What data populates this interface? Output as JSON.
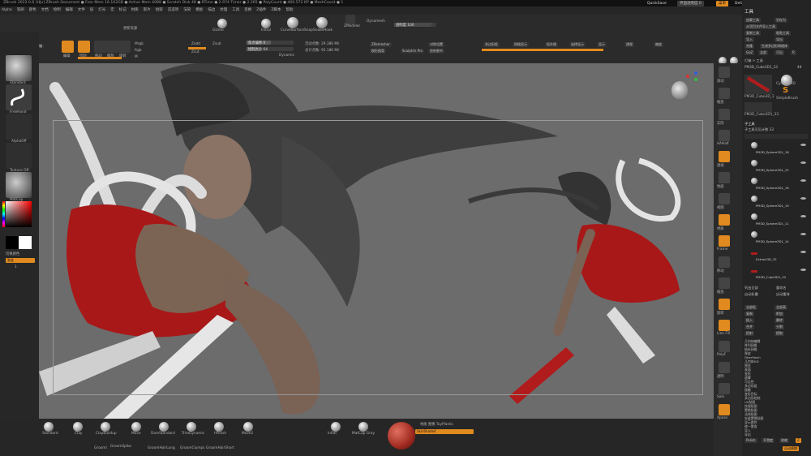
{
  "titlebar": {
    "text": "ZBrush 2022.0.6 [HJu]   ZBrush Document   ● Free Mem 16.102GB ● Active Mem 4088 ● Scratch Disk 48 ● RTime ● 2.974 Timer ● 2.265 ● PolyCount ● 400.572 KP ● MeshCount ● 1"
  },
  "topright": {
    "quicksave": "QuickSave",
    "transparency": "界面透明度 0",
    "menus": "菜单",
    "default_script": "DefaultZScript"
  },
  "menubar": {
    "items": [
      "Alpha",
      "笔刷",
      "颜色",
      "文档",
      "绘制",
      "编辑",
      "文件",
      "层",
      "灯光",
      "宏",
      "标记",
      "材质",
      "影片",
      "拾取",
      "首选项",
      "渲染",
      "模板",
      "描边",
      "纹理",
      "工具",
      "变换",
      "Z插件",
      "Z脚本",
      "帮助"
    ]
  },
  "shelf": {
    "thumbnail_label": "Thumbnail Size",
    "projection_master": "Projection Master",
    "lightbox": "灯箱",
    "store_label": "更新资源",
    "edit": "编辑",
    "draw": "绘制",
    "move": "移动",
    "scale": "缩放",
    "rotate": "旋转",
    "mrgb": "Mrgb",
    "rgb": "Rgb",
    "m": "M",
    "zadd": "Zadd",
    "zsub": "Zsub",
    "zcut": "Zcut",
    "focal_shift": "焦点偏移 0",
    "draw_size": "绘制大小 64",
    "dynamic": "Dynamic",
    "active_points": "活动点数: 29.386 Mil",
    "total_points": "总计点数: 95.186 Mil",
    "cam_label": "CamView",
    "sculptris": "Sculptris Pro",
    "gizmo": "Gizmo",
    "zremesher": "ZRemesher",
    "symmetry": "对称设置",
    "transp": "透明度 100",
    "tools": [
      "Gizmo",
      "Initial",
      "CurveSurfaceSnap",
      "SnakeHook",
      "ZModeler",
      "Dynamesh"
    ],
    "poly_frame": "多边形框",
    "right_buttons": [
      "拓扑格",
      "选择显示",
      "显示",
      "透视",
      "缩放"
    ],
    "extra": [
      "楔形图案",
      "投射细节",
      "网格显示"
    ]
  },
  "leftpanel": {
    "tiles": [
      "Standard",
      "FreeHand",
      "AlphaOff",
      "Texture Off",
      "MatCap"
    ],
    "switch_color": "切换颜色",
    "gradient": "渐变",
    "brush_count": "1"
  },
  "bottombar": {
    "brushes": [
      "Standard",
      "Clay",
      "ClayBuildup",
      "Move",
      "DamStandard",
      "GroomLengthen",
      "TrimDynamic",
      "hPolish",
      "Move2",
      "Inflat",
      "Pinch",
      "MatCap Gray"
    ],
    "brushes2": [
      "Grooml",
      "GroomSpike",
      "GroomHairLong",
      "GroomClumps",
      "GroomHairShort"
    ],
    "material": "材质 图像 ToyPlastic",
    "material_label": "SkinShade4"
  },
  "righticons": {
    "items": [
      "滚动",
      "缩放",
      "实际",
      "AAHalf",
      "透视",
      "地面",
      "视图",
      "材质",
      "Frame",
      "移动",
      "缩放",
      "旋转",
      "Line Fill",
      "PolyF",
      "透明",
      "Solo",
      "Xpose"
    ]
  },
  "rightpanel": {
    "title": "工具",
    "rows": [
      [
        "加载工具",
        "另存为"
      ],
      [
        "从项目文件导入工具",
        ""
      ],
      [
        "复制工具",
        "粘贴工具"
      ],
      [
        "导入",
        "导出"
      ],
      [
        "克隆",
        "生成多边形网格体"
      ],
      [
        "GoZ",
        "全部",
        "可见",
        "R"
      ]
    ],
    "lightbox_tools": "灯箱 > 工具",
    "pm3d": "PM3D_Cube3D1_33",
    "pm3d_count": "48",
    "tool_thumbs": [
      "PM3D_Cube3D_1",
      "Cylinder3D",
      "SimpleBrush",
      "PM3D_Cube3D1_33"
    ],
    "subtool_title": "子工具",
    "subtool_count": "子工具可见计数 33",
    "subtools": [
      "PM3D_Sphere3D1_18",
      "PM3D_Sphere3D1_22",
      "PM3D_Sphere3D1_16",
      "PM3D_Sphere3D1_19",
      "PM3D_Sphere3D1_11",
      "PM3D_Sphere3D1_14",
      "Extract3D_32",
      "PM3D_Cube3D1_33"
    ],
    "list_all": "列出全部",
    "auto_collapse": "自动折叠",
    "rename": "重命名",
    "auto_reorder": "自动重排",
    "actions": [
      [
        "全部低",
        "全部高"
      ],
      [
        "复制",
        "附加"
      ],
      [
        "插入",
        "删除"
      ],
      [
        "合并",
        "分割"
      ],
      [
        "投射",
        "提取"
      ]
    ],
    "lower_items": [
      "几何体编辑",
      "阵列网格",
      "纳米网格",
      "厚皮",
      "FiberMesh",
      "几何体HD",
      "预览",
      "表面",
      "变形",
      "遮罩",
      "可见性",
      "多边形组",
      "接触",
      "变形目标",
      "多边形绘制",
      "UV贴图",
      "纹理贴图",
      "置换贴图",
      "法线贴图",
      "矢量置换贴图",
      "显示属性",
      "统一蒙皮",
      "导入",
      "导出"
    ],
    "bottom_buttons": [
      "Polish",
      "平滑度",
      "收缩",
      "Z"
    ],
    "footer_right": "运动模糊"
  }
}
